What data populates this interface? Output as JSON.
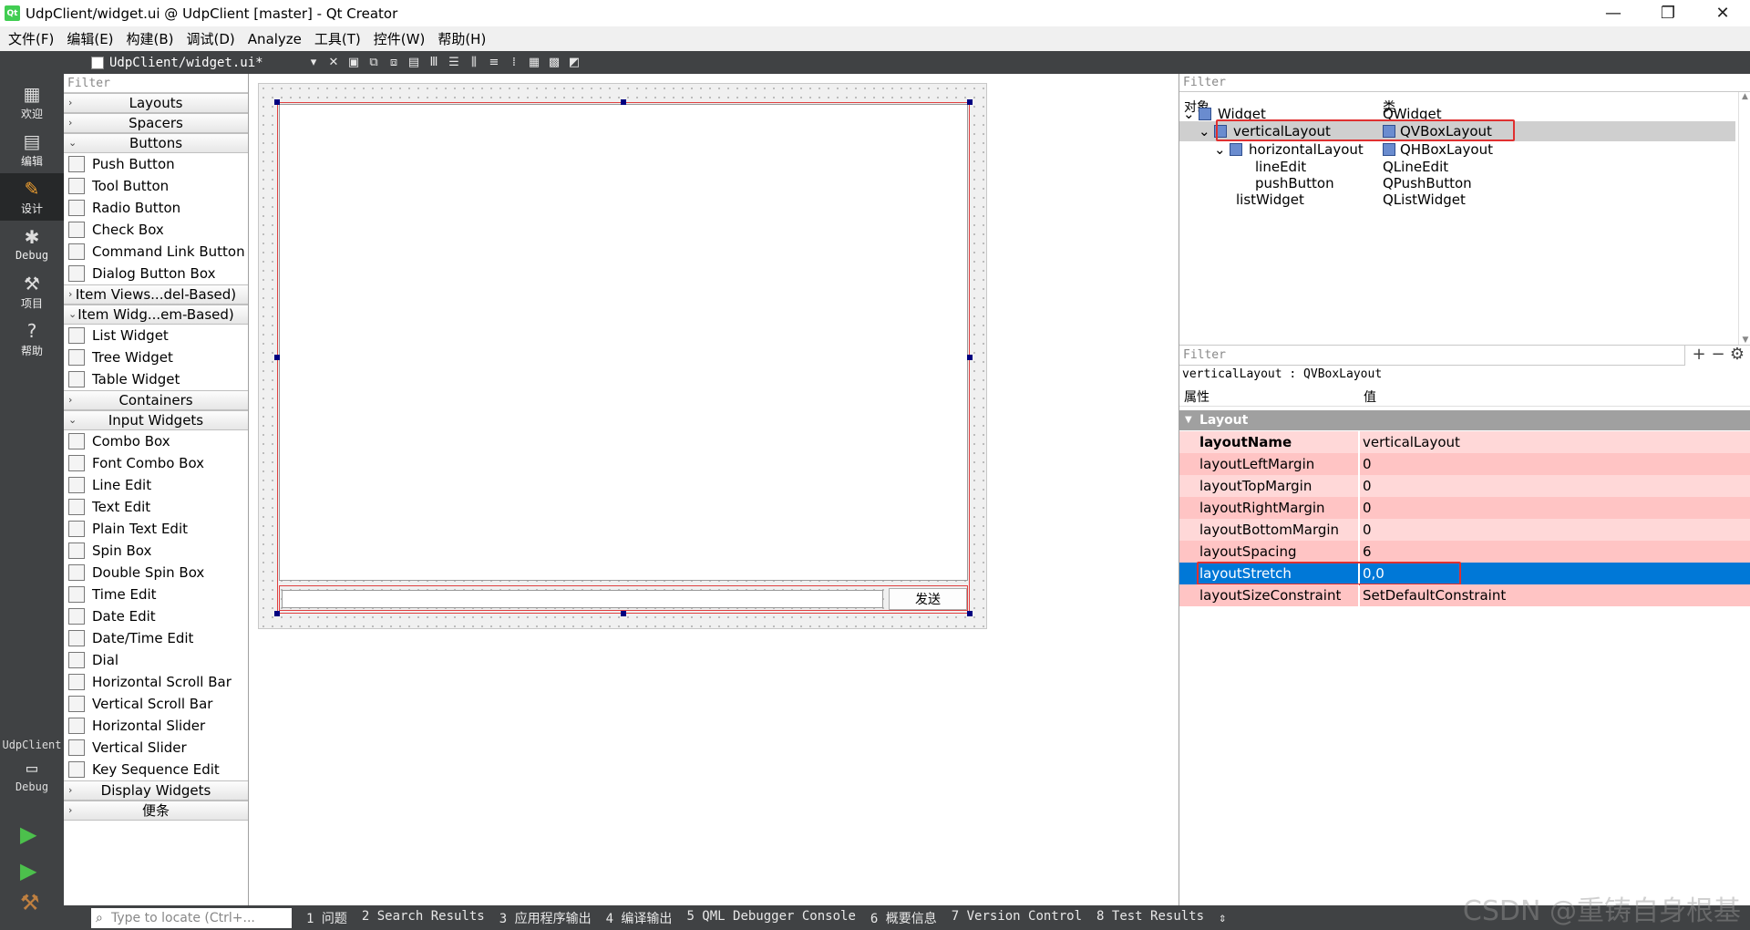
{
  "window": {
    "title": "UdpClient/widget.ui @ UdpClient [master] - Qt Creator",
    "app_icon": "qt-logo-icon",
    "minimize": "—",
    "maximize": "❐",
    "close": "✕"
  },
  "menubar": [
    "文件(F)",
    "编辑(E)",
    "构建(B)",
    "调试(D)",
    "Analyze",
    "工具(T)",
    "控件(W)",
    "帮助(H)"
  ],
  "modes": [
    {
      "label": "欢迎",
      "icon": "grid-icon"
    },
    {
      "label": "编辑",
      "icon": "edit-icon"
    },
    {
      "label": "设计",
      "icon": "pencil-icon",
      "active": true
    },
    {
      "label": "Debug",
      "icon": "bug-icon"
    },
    {
      "label": "项目",
      "icon": "wrench-icon"
    },
    {
      "label": "帮助",
      "icon": "help-icon"
    }
  ],
  "kit": {
    "project": "UdpClient",
    "build": "Debug"
  },
  "editor": {
    "file": "UdpClient/widget.ui*"
  },
  "widgetbox": {
    "filter_placeholder": "Filter",
    "categories": [
      {
        "name": "Layouts",
        "expanded": false,
        "items": []
      },
      {
        "name": "Spacers",
        "expanded": false,
        "items": []
      },
      {
        "name": "Buttons",
        "expanded": true,
        "items": [
          "Push Button",
          "Tool Button",
          "Radio Button",
          "Check Box",
          "Command Link Button",
          "Dialog Button Box"
        ]
      },
      {
        "name": "Item Views...del-Based)",
        "expanded": false,
        "items": []
      },
      {
        "name": "Item Widg...em-Based)",
        "expanded": true,
        "items": [
          "List Widget",
          "Tree Widget",
          "Table Widget"
        ]
      },
      {
        "name": "Containers",
        "expanded": false,
        "items": []
      },
      {
        "name": "Input Widgets",
        "expanded": true,
        "items": [
          "Combo Box",
          "Font Combo Box",
          "Line Edit",
          "Text Edit",
          "Plain Text Edit",
          "Spin Box",
          "Double Spin Box",
          "Time Edit",
          "Date Edit",
          "Date/Time Edit",
          "Dial",
          "Horizontal Scroll Bar",
          "Vertical Scroll Bar",
          "Horizontal Slider",
          "Vertical Slider",
          "Key Sequence Edit"
        ]
      },
      {
        "name": "Display Widgets",
        "expanded": false,
        "items": []
      },
      {
        "name": "便条",
        "expanded": false,
        "items": []
      }
    ]
  },
  "form": {
    "send_button": "发送"
  },
  "object_inspector": {
    "filter_placeholder": "Filter",
    "col_object": "对象",
    "col_class": "类",
    "rows": [
      {
        "name": "Widget",
        "class": "QWidget",
        "depth": 0,
        "expander": "v"
      },
      {
        "name": "verticalLayout",
        "class": "QVBoxLayout",
        "depth": 1,
        "expander": "v",
        "selected": true
      },
      {
        "name": "horizontalLayout",
        "class": "QHBoxLayout",
        "depth": 2,
        "expander": "v"
      },
      {
        "name": "lineEdit",
        "class": "QLineEdit",
        "depth": 3,
        "expander": ""
      },
      {
        "name": "pushButton",
        "class": "QPushButton",
        "depth": 3,
        "expander": ""
      },
      {
        "name": "listWidget",
        "class": "QListWidget",
        "depth": 2,
        "expander": ""
      }
    ]
  },
  "property_editor": {
    "filter_placeholder": "Filter",
    "class_line": "verticalLayout : QVBoxLayout",
    "col_property": "属性",
    "col_value": "值",
    "group": "Layout",
    "rows": [
      {
        "name": "layoutName",
        "value": "verticalLayout",
        "bold": true
      },
      {
        "name": "layoutLeftMargin",
        "value": "0"
      },
      {
        "name": "layoutTopMargin",
        "value": "0"
      },
      {
        "name": "layoutRightMargin",
        "value": "0"
      },
      {
        "name": "layoutBottomMargin",
        "value": "0"
      },
      {
        "name": "layoutSpacing",
        "value": "6"
      },
      {
        "name": "layoutStretch",
        "value": "0,0",
        "selected": true
      },
      {
        "name": "layoutSizeConstraint",
        "value": "SetDefaultConstraint"
      }
    ]
  },
  "bottombar": {
    "locator_placeholder": "Type to locate (Ctrl+...",
    "tabs": [
      "1 问题",
      "2 Search Results",
      "3 应用程序输出",
      "4 编译输出",
      "5 QML Debugger Console",
      "6 概要信息",
      "7 Version Control",
      "8 Test Results"
    ]
  },
  "watermark": "CSDN @重铸自身根基",
  "colors": {
    "mode_bar": "#404244",
    "selection": "#0078d7",
    "property_bg": "#ffc8c8",
    "highlight_box": "#e03030"
  }
}
